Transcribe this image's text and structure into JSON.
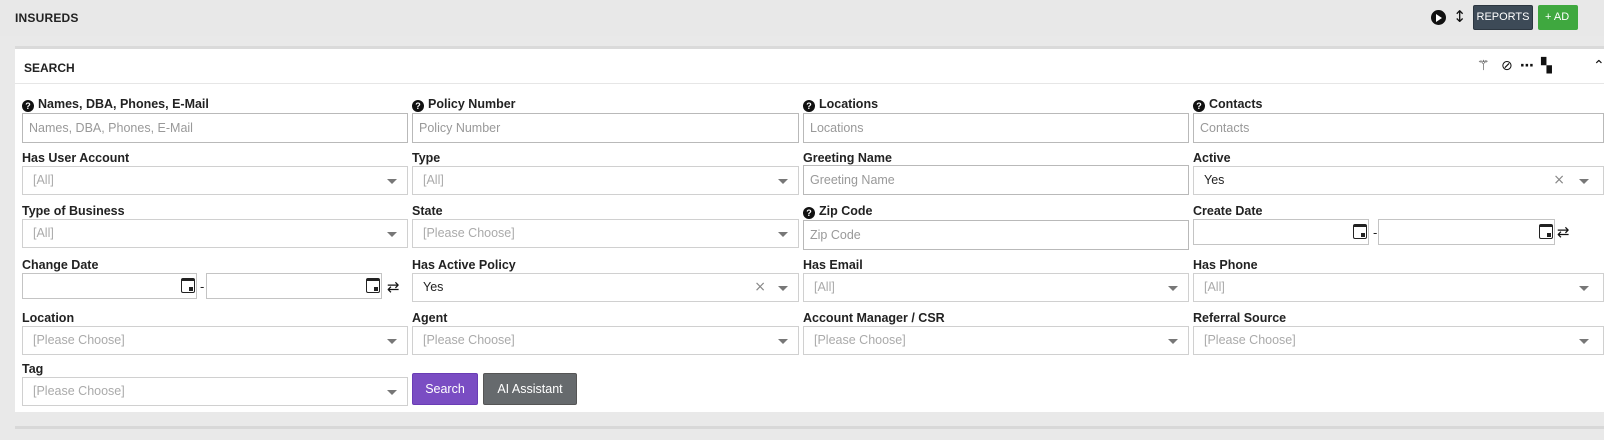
{
  "header": {
    "title": "INSUREDS",
    "reports_label": "REPORTS",
    "add_label": "+ AD"
  },
  "panel": {
    "title": "SEARCH"
  },
  "fields": {
    "names": {
      "label": "Names, DBA, Phones, E-Mail",
      "placeholder": "Names, DBA, Phones, E-Mail"
    },
    "policy_number": {
      "label": "Policy Number",
      "placeholder": "Policy Number"
    },
    "locations": {
      "label": "Locations",
      "placeholder": "Locations"
    },
    "contacts": {
      "label": "Contacts",
      "placeholder": "Contacts"
    },
    "has_user_account": {
      "label": "Has User Account",
      "value": "[All]"
    },
    "type": {
      "label": "Type",
      "value": "[All]"
    },
    "greeting_name": {
      "label": "Greeting Name",
      "placeholder": "Greeting Name"
    },
    "active": {
      "label": "Active",
      "value": "Yes"
    },
    "type_of_business": {
      "label": "Type of Business",
      "value": "[All]"
    },
    "state": {
      "label": "State",
      "value": "[Please Choose]"
    },
    "zip_code": {
      "label": "Zip Code",
      "placeholder": "Zip Code"
    },
    "create_date": {
      "label": "Create Date",
      "separator": "-"
    },
    "change_date": {
      "label": "Change Date",
      "separator": "-"
    },
    "has_active_policy": {
      "label": "Has Active Policy",
      "value": "Yes"
    },
    "has_email": {
      "label": "Has Email",
      "value": "[All]"
    },
    "has_phone": {
      "label": "Has Phone",
      "value": "[All]"
    },
    "location": {
      "label": "Location",
      "value": "[Please Choose]"
    },
    "agent": {
      "label": "Agent",
      "value": "[Please Choose]"
    },
    "account_manager": {
      "label": "Account Manager / CSR",
      "value": "[Please Choose]"
    },
    "referral_source": {
      "label": "Referral Source",
      "value": "[Please Choose]"
    },
    "tag": {
      "label": "Tag",
      "value": "[Please Choose]"
    }
  },
  "buttons": {
    "search": "Search",
    "ai_assistant": "AI Assistant"
  },
  "icons": {
    "help": "?",
    "clear": "×",
    "swap": "⇄",
    "dash": "-"
  },
  "colors": {
    "search_button": "#7a4dc3",
    "ai_button": "#666a6d",
    "reports_button": "#3d4a57",
    "add_button": "#3fa83f"
  }
}
